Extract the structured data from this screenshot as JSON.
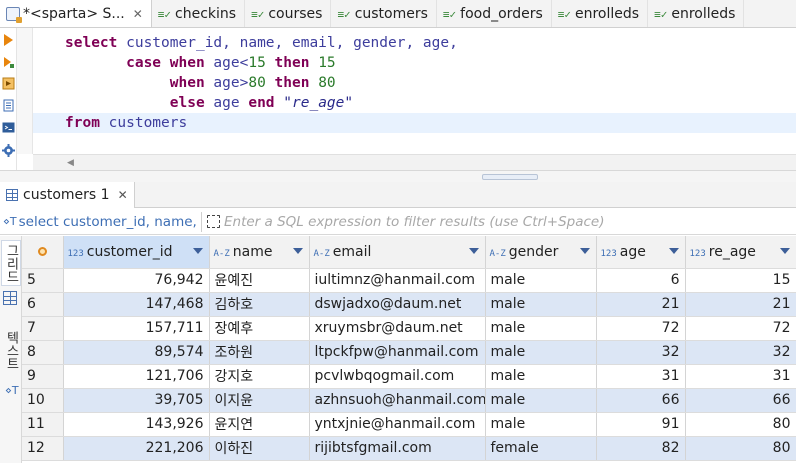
{
  "editor_tabs": [
    {
      "label": "*<sparta> S...",
      "active": true
    },
    {
      "label": "checkins"
    },
    {
      "label": "courses"
    },
    {
      "label": "customers"
    },
    {
      "label": "food_orders"
    },
    {
      "label": "enrolleds"
    },
    {
      "label": "enrolleds"
    }
  ],
  "tab_icon_glyph": "≡✓",
  "sql": {
    "l1": {
      "kw": "select",
      "rest": " customer_id, name, email, gender, age,"
    },
    "l2": {
      "indent": "       ",
      "kw1": "case",
      "kw2": "when",
      "col": " age<",
      "num": "15",
      "kw3": "then",
      "num2": "15"
    },
    "l3": {
      "indent": "            ",
      "kw2": "when",
      "col": " age>",
      "num": "80",
      "kw3": "then",
      "num2": "80"
    },
    "l4": {
      "indent": "            ",
      "kw": "else",
      "col": " age ",
      "kw2": "end",
      "alias": "\"re_age\""
    },
    "l5": {
      "kw": "from",
      "rest": " customers"
    }
  },
  "result_tab": {
    "label": "customers 1"
  },
  "filter": {
    "query_text": "select customer_id, name,",
    "placeholder": "Enter a SQL expression to filter results (use Ctrl+Space)"
  },
  "side_tabs": {
    "grid": "그리드",
    "text": "텍스트"
  },
  "columns": [
    {
      "type": "123",
      "label": "customer_id",
      "selected": true
    },
    {
      "type": "A-Z",
      "label": "name"
    },
    {
      "type": "A-Z",
      "label": "email"
    },
    {
      "type": "A-Z",
      "label": "gender"
    },
    {
      "type": "123",
      "label": "age"
    },
    {
      "type": "123",
      "label": "re_age"
    }
  ],
  "rows": [
    {
      "rn": "5",
      "customer_id": "76,942",
      "name": "윤예진",
      "email": "iultimnz@hanmail.com",
      "gender": "male",
      "age": "6",
      "re_age": "15"
    },
    {
      "rn": "6",
      "customer_id": "147,468",
      "name": "김하호",
      "email": "dswjadxo@daum.net",
      "gender": "male",
      "age": "21",
      "re_age": "21"
    },
    {
      "rn": "7",
      "customer_id": "157,711",
      "name": "장예후",
      "email": "xruymsbr@daum.net",
      "gender": "male",
      "age": "72",
      "re_age": "72"
    },
    {
      "rn": "8",
      "customer_id": "89,574",
      "name": "조하원",
      "email": "ltpckfpw@hanmail.com",
      "gender": "male",
      "age": "32",
      "re_age": "32"
    },
    {
      "rn": "9",
      "customer_id": "121,706",
      "name": "강지호",
      "email": "pcvlwbqogmail.com",
      "gender": "male",
      "age": "31",
      "re_age": "31"
    },
    {
      "rn": "10",
      "customer_id": "39,705",
      "name": "이지윤",
      "email": "azhnsuoh@hanmail.com",
      "gender": "male",
      "age": "66",
      "re_age": "66"
    },
    {
      "rn": "11",
      "customer_id": "143,926",
      "name": "윤지연",
      "email": "yntxjnie@hanmail.com",
      "gender": "male",
      "age": "91",
      "re_age": "80"
    },
    {
      "rn": "12",
      "customer_id": "221,206",
      "name": "이하진",
      "email": "rijibtsfgmail.com",
      "gender": "female",
      "age": "82",
      "re_age": "80"
    }
  ],
  "colors": {
    "keyword": "#7f0055",
    "selected_header": "#cfe0f6",
    "alt_row": "#dce6f5",
    "accent": "#3d6eb4"
  }
}
